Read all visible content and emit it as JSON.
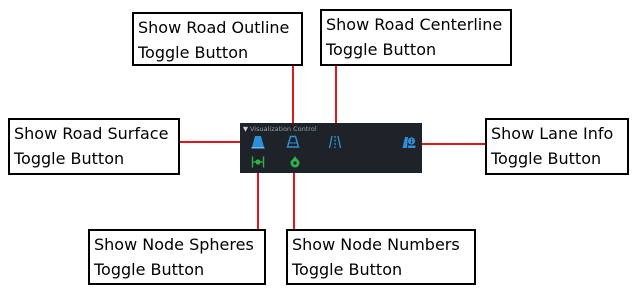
{
  "panel": {
    "title": "Visualization Control",
    "collapse_glyph": "▼",
    "bg_color": "#1e2329",
    "accent_color": "#2f8fd6",
    "green_color": "#2fb24a"
  },
  "callouts": {
    "road_outline": {
      "line1": "Show Road Outline",
      "line2": "Toggle Button"
    },
    "road_centerline": {
      "line1": "Show Road Centerline",
      "line2": "Toggle Button"
    },
    "road_surface": {
      "line1": "Show Road Surface",
      "line2": "Toggle Button"
    },
    "lane_info": {
      "line1": "Show Lane Info",
      "line2": "Toggle Button"
    },
    "node_spheres": {
      "line1": "Show Node Spheres",
      "line2": "Toggle Button"
    },
    "node_numbers": {
      "line1": "Show Node Numbers",
      "line2": "Toggle Button"
    }
  },
  "icons": {
    "road_surface": "road-surface-icon",
    "road_outline": "road-outline-icon",
    "road_centerline": "road-centerline-icon",
    "lane_info": "lane-info-icon",
    "node_spheres": "node-spheres-icon",
    "node_numbers": "node-numbers-icon"
  },
  "connector_color": "#e3141c"
}
